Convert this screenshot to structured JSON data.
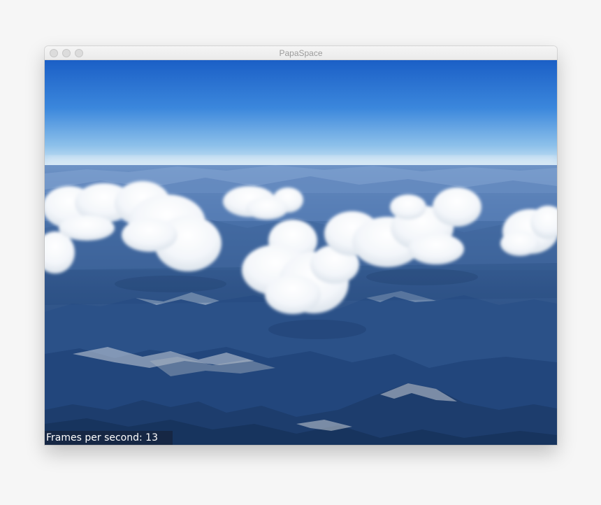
{
  "window": {
    "title": "PapaSpace"
  },
  "overlay": {
    "fps_label": "Frames per second: 13"
  },
  "colors": {
    "sky_top": "#1f63c9",
    "sky_horizon": "#cfe4f5",
    "terrain_far": "#5f86bf",
    "terrain_near": "#1c3f6f",
    "cloud": "#ffffff"
  }
}
